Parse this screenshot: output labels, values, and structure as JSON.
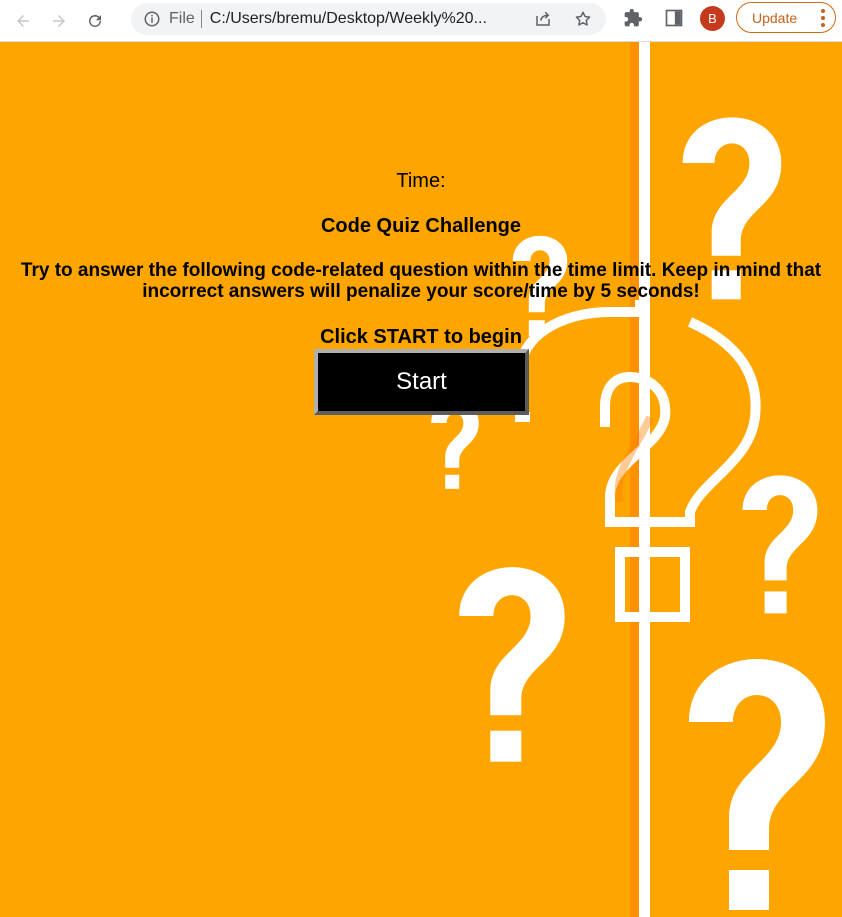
{
  "browser": {
    "scheme_label": "File",
    "url": "C:/Users/bremu/Desktop/Weekly%20...",
    "avatar_letter": "B",
    "update_label": "Update"
  },
  "quiz": {
    "timer_label": "Time:",
    "title": "Code Quiz Challenge",
    "instructions": "Try to answer the following code-related question within the time limit. Keep in mind that incorrect answers will penalize your score/time by 5 seconds!",
    "prompt": "Click START to begin",
    "start_label": "Start"
  },
  "colors": {
    "page_background": "#ffa500",
    "button_background": "#000000",
    "button_text": "#ffffff",
    "art_white": "#ffffff",
    "art_shadow": "#ff7f00"
  },
  "icons": [
    "back-arrow-icon",
    "forward-arrow-icon",
    "reload-icon",
    "info-icon",
    "share-icon",
    "star-icon",
    "extensions-icon",
    "side-panel-icon",
    "menu-dots-icon",
    "question-mark-icon"
  ]
}
